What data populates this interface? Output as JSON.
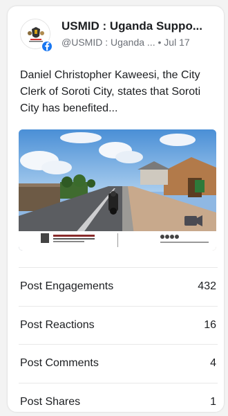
{
  "page": {
    "name": "USMID : Uganda Suppo...",
    "handle": "@USMID : Uganda ...",
    "separator": "•",
    "date": "Jul 17",
    "platform_icon": "facebook-icon"
  },
  "post": {
    "text": "Daniel Christopher Kaweesi, the City Clerk of Soroti City, states that Soroti City has benefited..."
  },
  "stats": [
    {
      "label": "Post Engagements",
      "value": "432"
    },
    {
      "label": "Post Reactions",
      "value": "16"
    },
    {
      "label": "Post Comments",
      "value": "4"
    },
    {
      "label": "Post Shares",
      "value": "1"
    }
  ],
  "colors": {
    "facebook_blue": "#1877f2",
    "meta_text": "#6b6f76",
    "divider": "#e8e8e8"
  }
}
